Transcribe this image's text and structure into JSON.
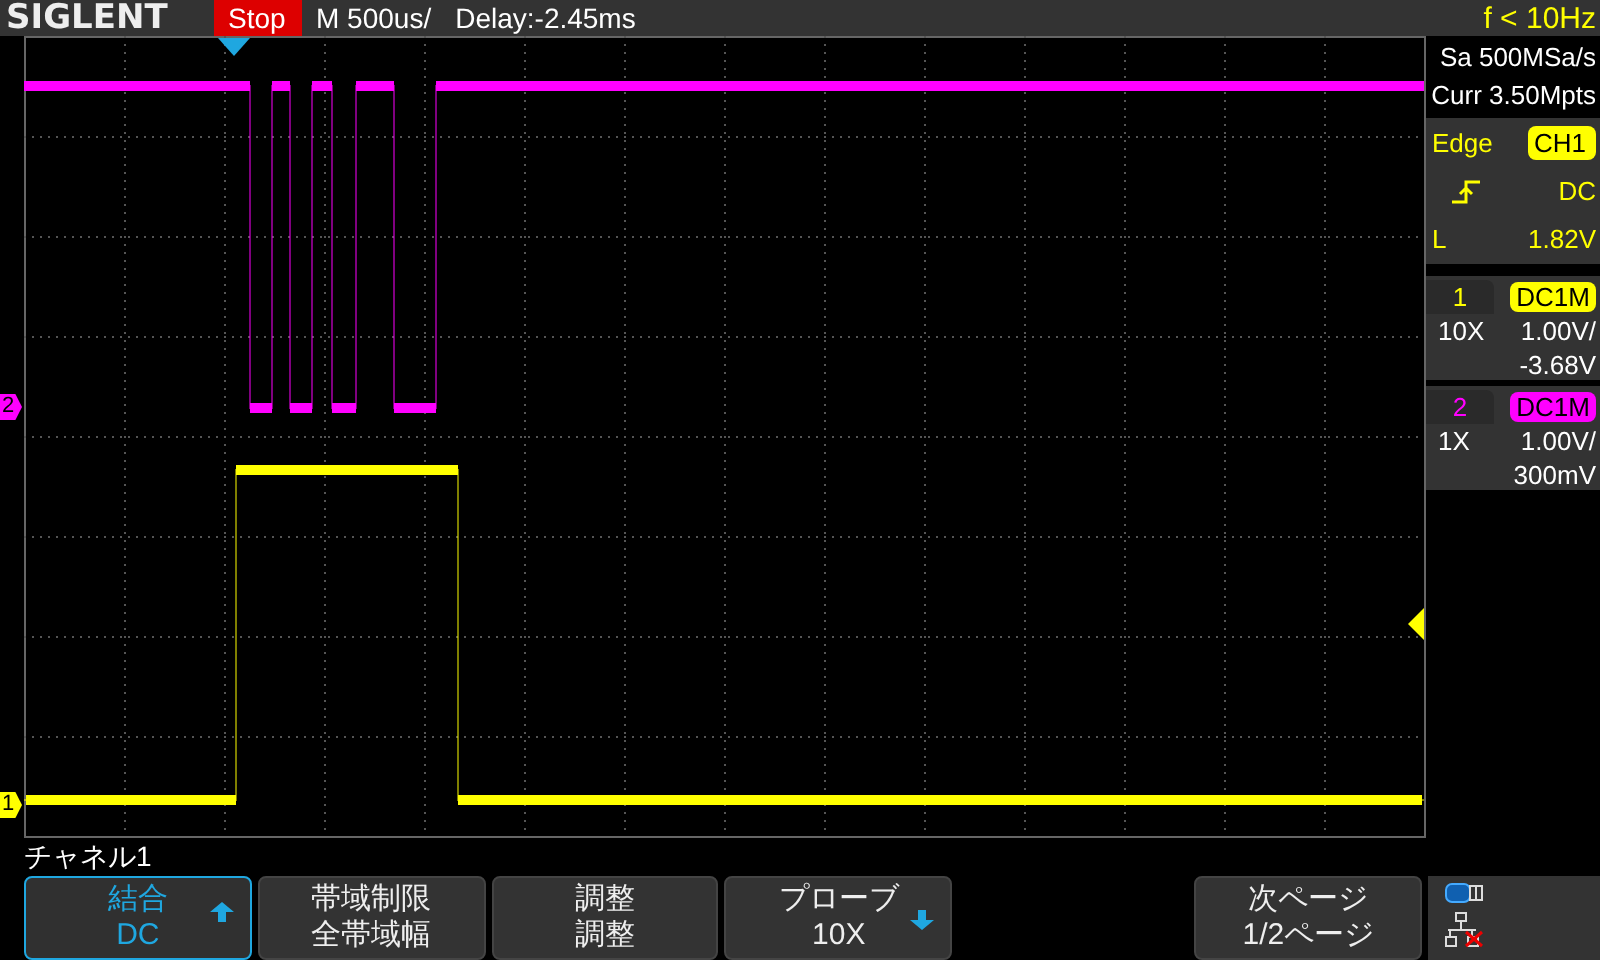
{
  "top_bar": {
    "logo": "SIGLENT",
    "run_state": "Stop",
    "timebase": "M 500us/",
    "delay": "Delay:-2.45ms",
    "frequency": "f < 10Hz"
  },
  "display": {
    "channel_markers": [
      {
        "label": "2",
        "color": "#ff00ff"
      },
      {
        "label": "1",
        "color": "#ffff00"
      }
    ]
  },
  "acquisition": {
    "sample_rate": "Sa 500MSa/s",
    "memory_depth": "Curr 3.50Mpts"
  },
  "trigger": {
    "type": "Edge",
    "source": "CH1",
    "coupling": "DC",
    "level_label": "L",
    "level_value": "1.82V"
  },
  "channels": [
    {
      "number": "1",
      "color": "#ffff00",
      "coupling": "DC1M",
      "probe": "10X",
      "scale": "1.00V/",
      "offset": "-3.68V"
    },
    {
      "number": "2",
      "color": "#ff00ff",
      "coupling": "DC1M",
      "probe": "1X",
      "scale": "1.00V/",
      "offset": "300mV"
    }
  ],
  "menu": {
    "title": "チャネル1",
    "buttons": [
      {
        "kind": "up",
        "label": "結合",
        "value": "DC",
        "selected": true
      },
      {
        "kind": "plain",
        "label": "帯域制限",
        "value": "全帯域幅",
        "selected": false
      },
      {
        "kind": "plain",
        "label": "調整",
        "value": "調整",
        "selected": false
      },
      {
        "kind": "down",
        "label": "プローブ",
        "value": "10X",
        "selected": false
      }
    ],
    "next_page": {
      "label": "次ページ",
      "value": "1/2ページ",
      "selected": false
    }
  }
}
